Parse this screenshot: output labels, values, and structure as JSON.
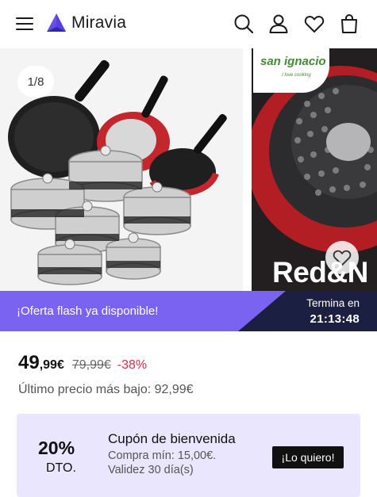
{
  "header": {
    "logo_text": "Miravia",
    "icons": [
      "menu-icon",
      "search-icon",
      "user-icon",
      "heart-icon",
      "shopping-bag-icon"
    ]
  },
  "gallery": {
    "counter": "1/8",
    "brand_name": "san ignacio",
    "brand_tagline": "I love cooking",
    "banner_text": "Red&N"
  },
  "flash_sale": {
    "label": "¡Oferta flash ya disponible!",
    "ends_label": "Termina en",
    "time": "21:13:48"
  },
  "price": {
    "integer": "49",
    "decimal": ",99€",
    "old": "79,99€",
    "discount": "-38%",
    "lowest_label": "Último precio más bajo: 92,99€"
  },
  "coupon": {
    "percent": "20%",
    "off_label": "DTO.",
    "title": "Cupón de bienvenida",
    "min_purchase": "Compra mín: 15,00€.",
    "validity": "Validez 30 día(s)",
    "button_label": "¡Lo quiero!"
  },
  "colors": {
    "accent": "#7b63f2",
    "flash_dark": "#1b1f42",
    "discount": "#e4284a",
    "coupon_bg": "#e9e6fd"
  }
}
